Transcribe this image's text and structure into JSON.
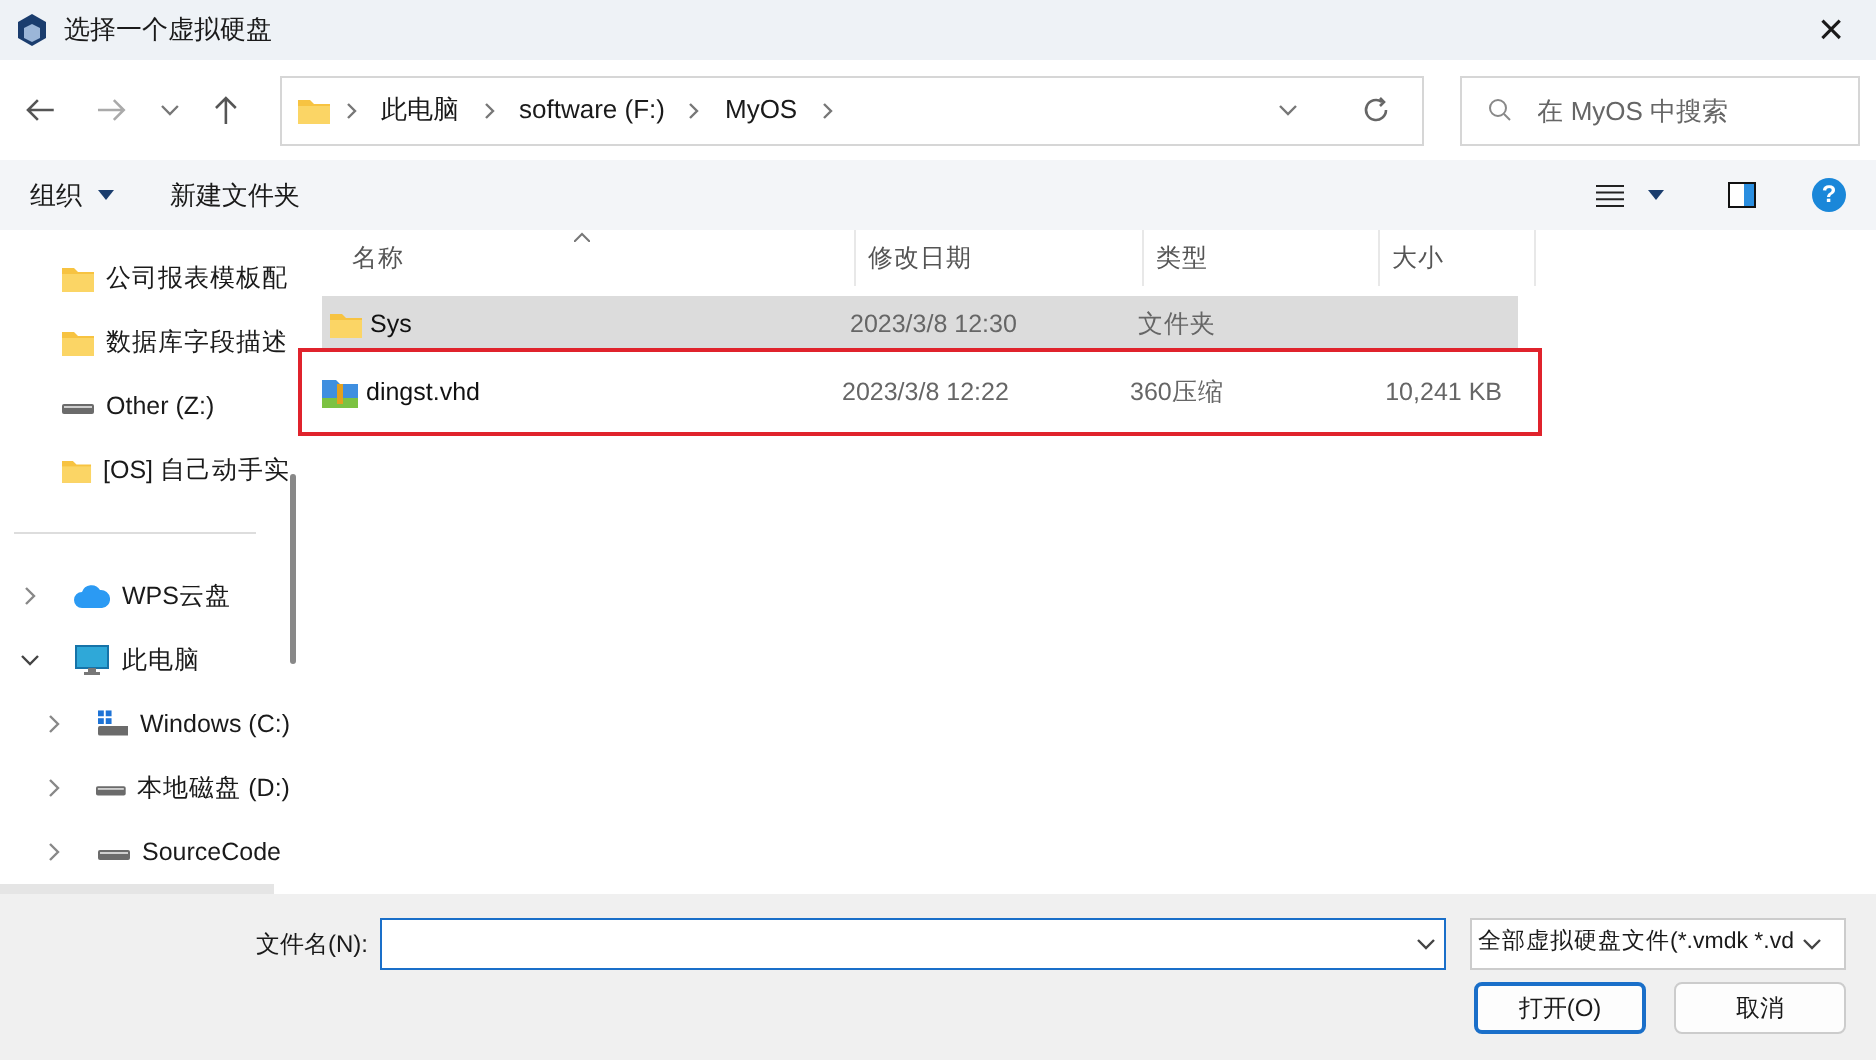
{
  "window": {
    "title": "选择一个虚拟硬盘",
    "close": "×"
  },
  "nav": {
    "breadcrumb": [
      "此电脑",
      "software (F:)",
      "MyOS"
    ],
    "search": {
      "placeholder": "在 MyOS 中搜索"
    }
  },
  "toolbar": {
    "organize": "组织",
    "new_folder": "新建文件夹",
    "help": "?"
  },
  "sidebar": {
    "quick_access": [
      {
        "kind": "folder",
        "label": "公司报表模板配"
      },
      {
        "kind": "folder",
        "label": "数据库字段描述"
      },
      {
        "kind": "drive",
        "label": "Other (Z:)"
      },
      {
        "kind": "folder",
        "label": "[OS] 自己动手实"
      }
    ],
    "tree": [
      {
        "kind": "cloud",
        "label": "WPS云盘",
        "expanded": false
      },
      {
        "kind": "pc",
        "label": "此电脑",
        "expanded": true,
        "children": [
          {
            "kind": "windows-drive",
            "label": "Windows (C:)",
            "expanded": false
          },
          {
            "kind": "drive",
            "label": "本地磁盘 (D:)",
            "expanded": false
          },
          {
            "kind": "drive",
            "label": "SourceCode",
            "expanded": false
          }
        ]
      }
    ]
  },
  "table": {
    "columns": [
      "名称",
      "修改日期",
      "类型",
      "大小"
    ],
    "rows": [
      {
        "kind": "folder",
        "name": "Sys",
        "modified": "2023/3/8 12:30",
        "type": "文件夹",
        "selected": true,
        "outlined": false
      },
      {
        "kind": "archive",
        "name": "dingst.vhd",
        "modified": "2023/3/8 12:22",
        "type": "360压缩",
        "size": "10,241 KB",
        "selected": false,
        "outlined": true
      }
    ]
  },
  "footer": {
    "filename_label": "文件名(N):",
    "filter": "全部虚拟硬盘文件(*.vmdk *.vd",
    "open": "打开(O)",
    "cancel": "取消"
  }
}
